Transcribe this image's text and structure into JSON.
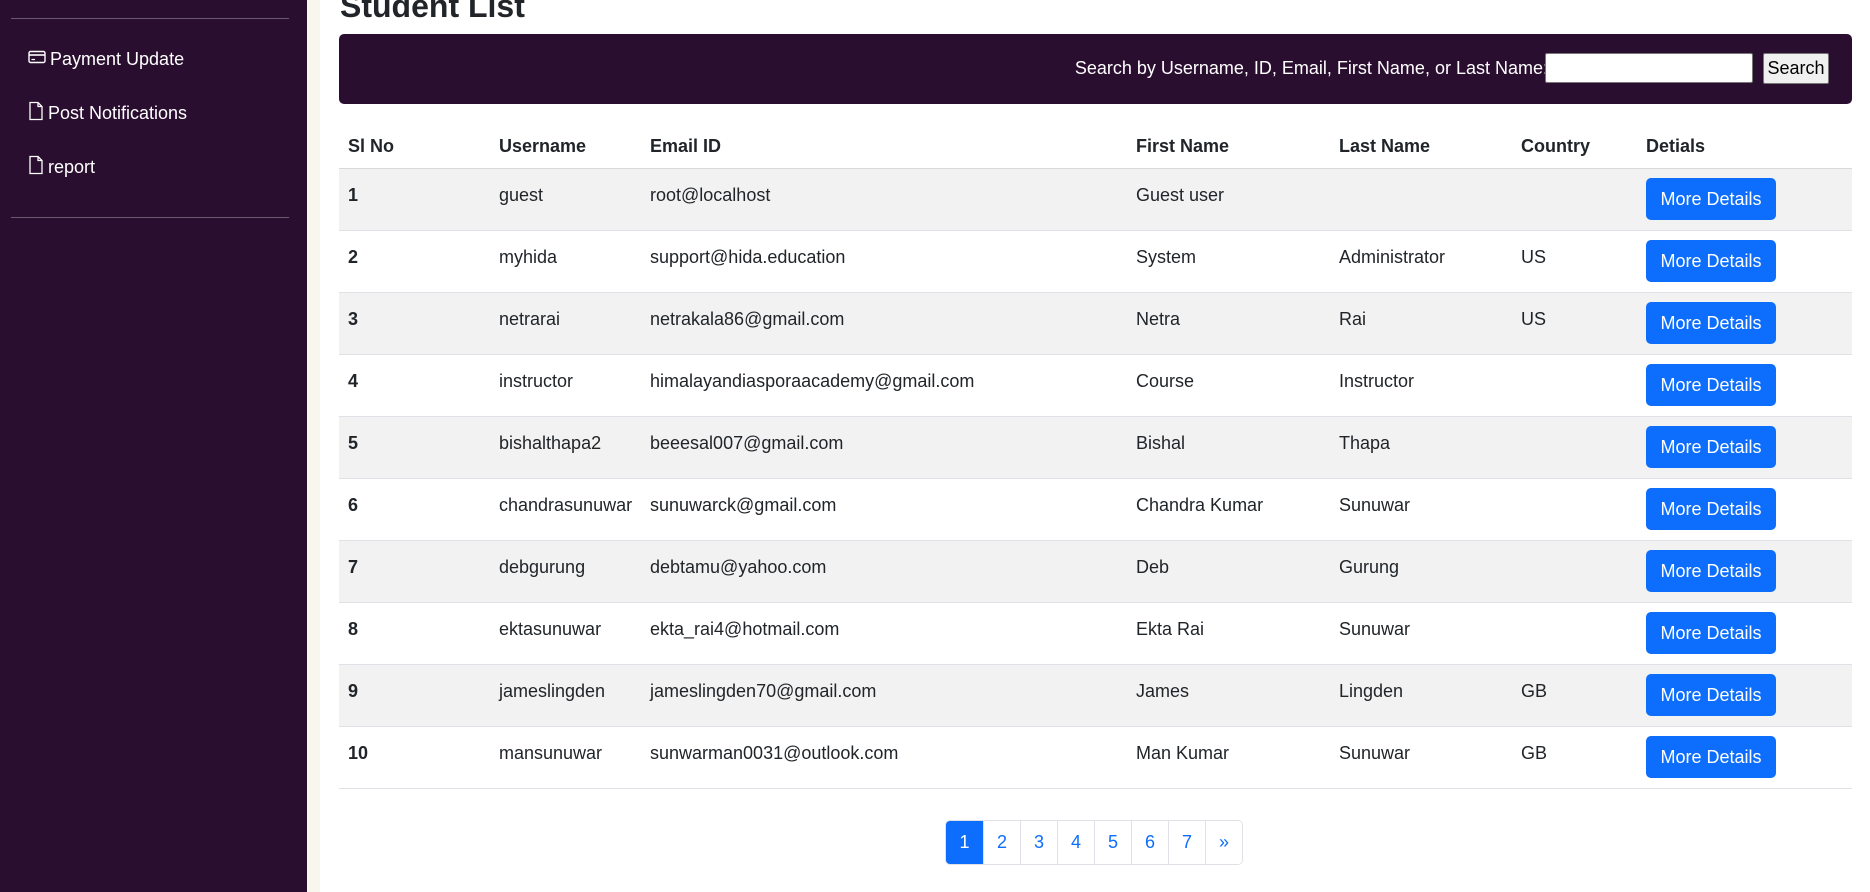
{
  "sidebar": {
    "items": [
      {
        "label": "Payment Update",
        "icon": "credit-card-icon"
      },
      {
        "label": "Post Notifications",
        "icon": "file-icon"
      },
      {
        "label": "report",
        "icon": "file-icon"
      }
    ]
  },
  "page": {
    "title": "Student List"
  },
  "search": {
    "label": "Search by Username, ID, Email, First Name, or Last Name:",
    "value": "",
    "button_label": "Search"
  },
  "table": {
    "headers": [
      "Sl No",
      "Username",
      "Email ID",
      "First Name",
      "Last Name",
      "Country",
      "Detials"
    ],
    "button_label": "More Details",
    "rows": [
      {
        "sl": "1",
        "username": "guest",
        "email": "root@localhost",
        "first": "Guest user",
        "last": "",
        "country": ""
      },
      {
        "sl": "2",
        "username": "myhida",
        "email": "support@hida.education",
        "first": "System",
        "last": "Administrator",
        "country": "US"
      },
      {
        "sl": "3",
        "username": "netrarai",
        "email": "netrakala86@gmail.com",
        "first": "Netra",
        "last": "Rai",
        "country": "US"
      },
      {
        "sl": "4",
        "username": "instructor",
        "email": "himalayandiasporaacademy@gmail.com",
        "first": "Course",
        "last": "Instructor",
        "country": ""
      },
      {
        "sl": "5",
        "username": "bishalthapa2",
        "email": "beeesal007@gmail.com",
        "first": "Bishal",
        "last": "Thapa",
        "country": ""
      },
      {
        "sl": "6",
        "username": "chandrasunuwar",
        "email": "sunuwarck@gmail.com",
        "first": "Chandra Kumar",
        "last": "Sunuwar",
        "country": ""
      },
      {
        "sl": "7",
        "username": "debgurung",
        "email": "debtamu@yahoo.com",
        "first": "Deb",
        "last": "Gurung",
        "country": ""
      },
      {
        "sl": "8",
        "username": "ektasunuwar",
        "email": "ekta_rai4@hotmail.com",
        "first": "Ekta Rai",
        "last": "Sunuwar",
        "country": ""
      },
      {
        "sl": "9",
        "username": "jameslingden",
        "email": "jameslingden70@gmail.com",
        "first": "James",
        "last": "Lingden",
        "country": "GB"
      },
      {
        "sl": "10",
        "username": "mansunuwar",
        "email": "sunwarman0031@outlook.com",
        "first": "Man Kumar",
        "last": "Sunuwar",
        "country": "GB"
      }
    ]
  },
  "pagination": {
    "pages": [
      "1",
      "2",
      "3",
      "4",
      "5",
      "6",
      "7",
      "»"
    ],
    "active": "1"
  },
  "colors": {
    "sidebar_bg": "#2a0e30",
    "primary": "#0d6efd"
  }
}
